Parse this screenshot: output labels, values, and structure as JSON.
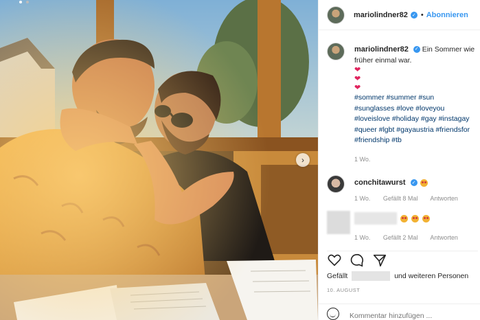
{
  "post": {
    "username": "mariolindner82",
    "separator": "•",
    "follow_label": "Abonnieren",
    "caption_text": "Ein Sommer wie früher einmal war.",
    "hearts": [
      "❤",
      "❤",
      "❤"
    ],
    "hashtags": "#sommer #summer #sun\n#sunglasses #love #loveyou\n#loveislove #holiday #gay #instagay\n#queer #lgbt #gayaustria #friendsfor\n#friendship #tb",
    "caption_time": "1 Wo."
  },
  "comments": [
    {
      "username": "conchitawurst",
      "time": "1 Wo.",
      "likes": "Gefällt 8 Mal",
      "reply": "Antworten"
    },
    {
      "time": "1 Wo.",
      "likes": "Gefällt 2 Mal",
      "reply": "Antworten"
    }
  ],
  "likes_line": {
    "prefix": "Gefällt",
    "suffix": "und weiteren Personen"
  },
  "date": "10. AUGUST",
  "add_comment_placeholder": "Kommentar hinzufügen ...",
  "icons": [
    "verified-badge-icon",
    "next-arrow-icon",
    "heart-icon",
    "comment-icon",
    "share-icon",
    "emoji-icon"
  ],
  "colors": {
    "accent": "#3897f0",
    "heart": "#e0245e",
    "hashtag": "#00376b",
    "muted": "#8e8e8e"
  }
}
